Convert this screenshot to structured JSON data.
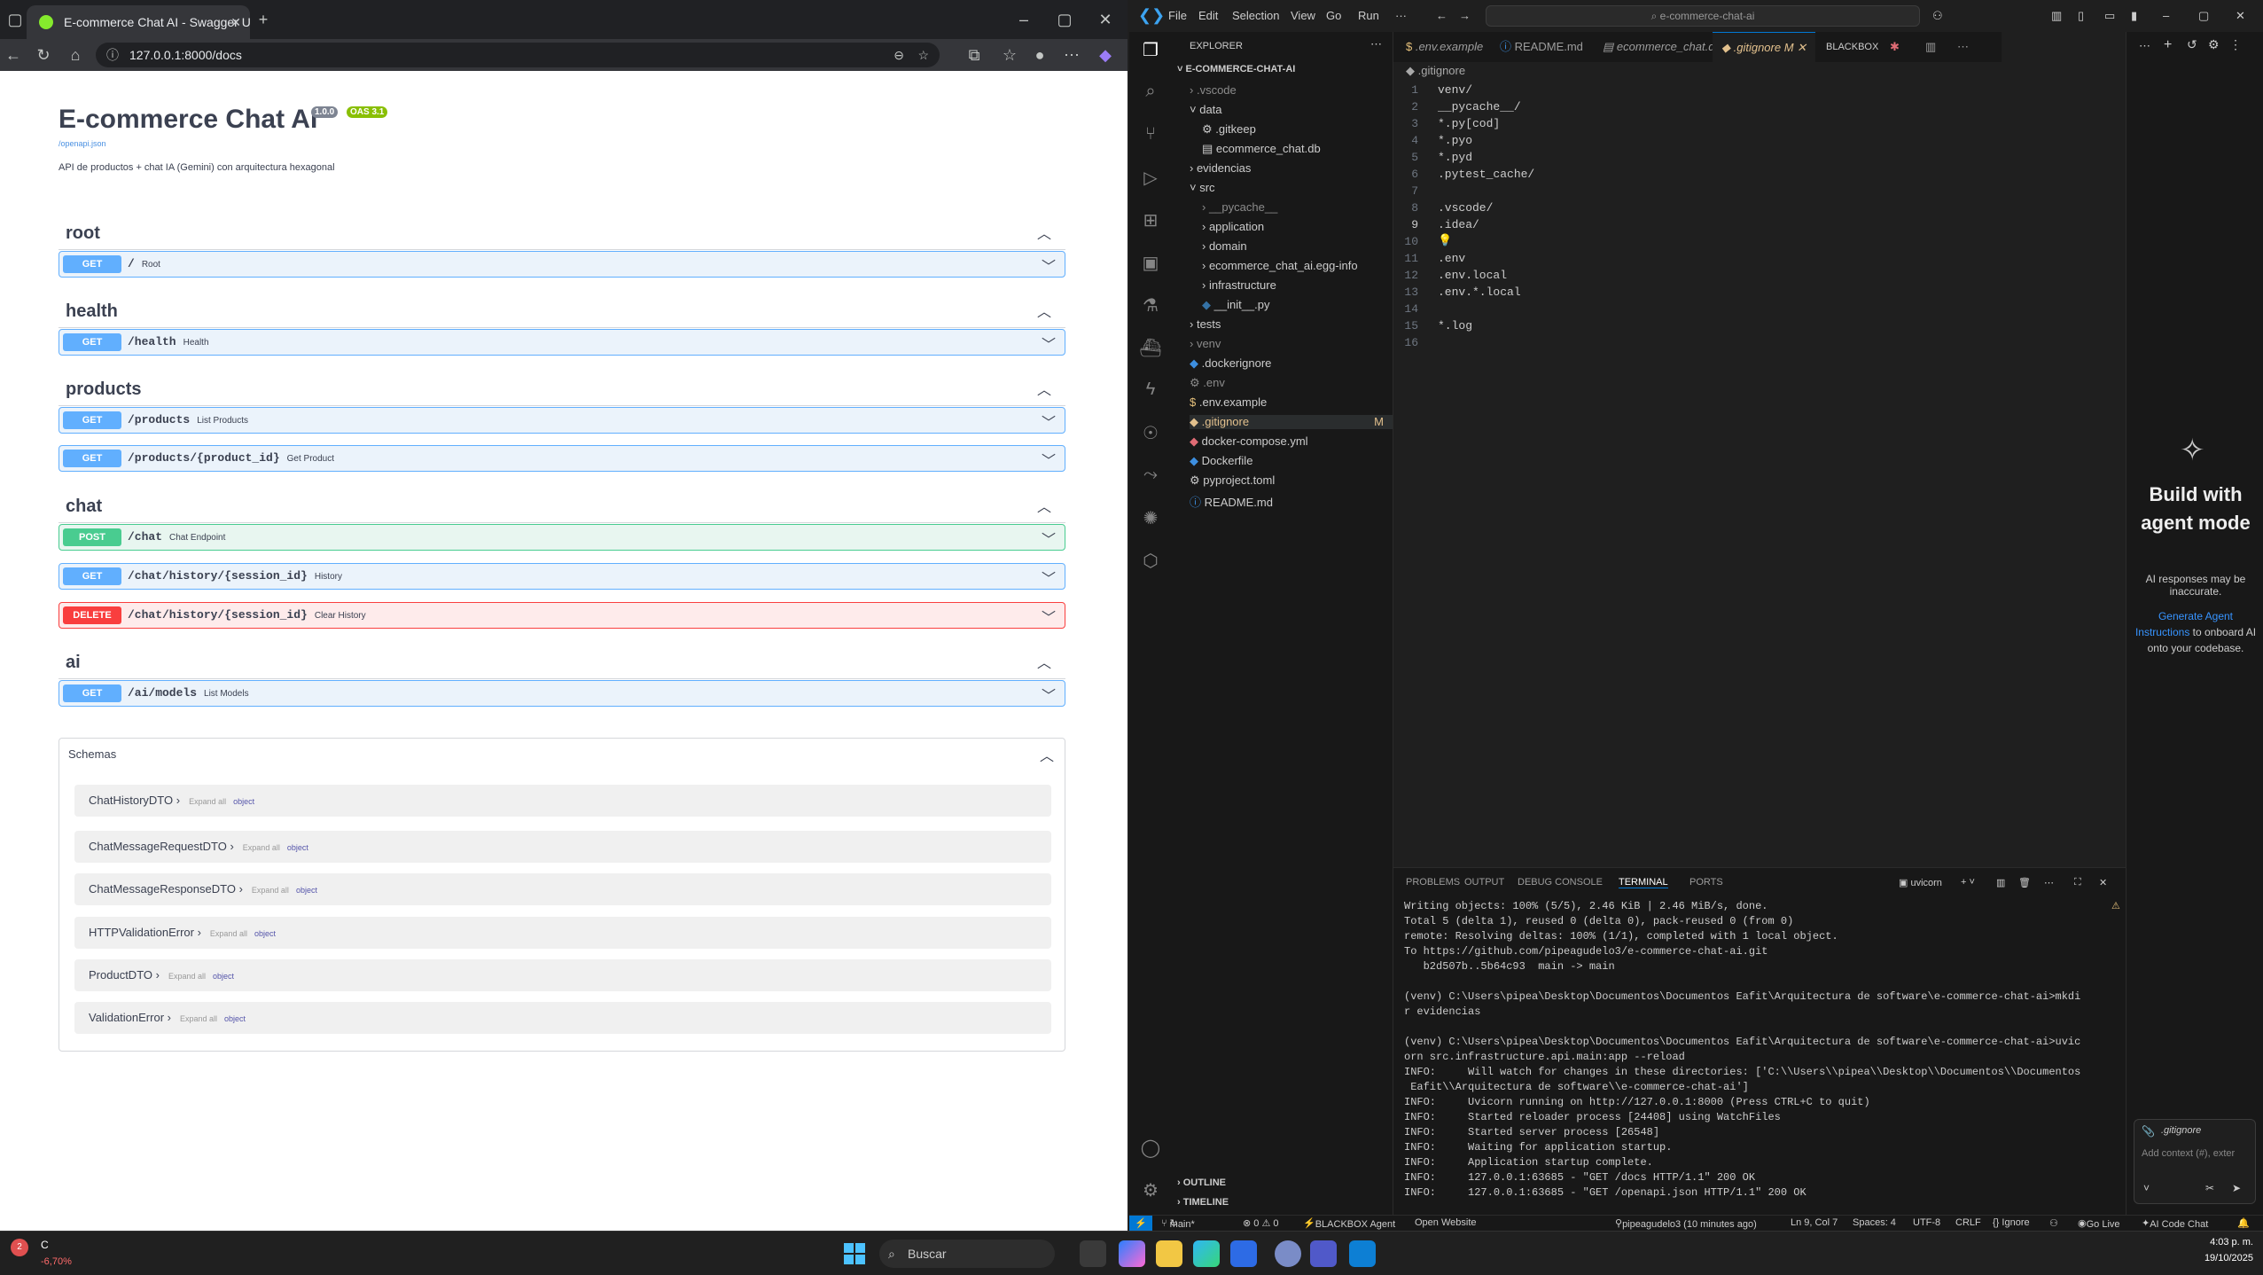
{
  "browser": {
    "tab_title": "E-commerce Chat AI - Swagger U",
    "url": "127.0.0.1:8000/docs"
  },
  "swagger": {
    "title": "E-commerce Chat AI",
    "version_badge": "1.0.0",
    "oas_badge": "OAS 3.1",
    "openapi_link": "/openapi.json",
    "description": "API de productos + chat IA (Gemini) con arquitectura hexagonal",
    "tags": [
      {
        "name": "root",
        "ops": [
          {
            "method": "GET",
            "path": "/",
            "summary": "Root"
          }
        ]
      },
      {
        "name": "health",
        "ops": [
          {
            "method": "GET",
            "path": "/health",
            "summary": "Health"
          }
        ]
      },
      {
        "name": "products",
        "ops": [
          {
            "method": "GET",
            "path": "/products",
            "summary": "List Products"
          },
          {
            "method": "GET",
            "path": "/products/{product_id}",
            "summary": "Get Product"
          }
        ]
      },
      {
        "name": "chat",
        "ops": [
          {
            "method": "POST",
            "path": "/chat",
            "summary": "Chat Endpoint"
          },
          {
            "method": "GET",
            "path": "/chat/history/{session_id}",
            "summary": "History"
          },
          {
            "method": "DELETE",
            "path": "/chat/history/{session_id}",
            "summary": "Clear History"
          }
        ]
      },
      {
        "name": "ai",
        "ops": [
          {
            "method": "GET",
            "path": "/ai/models",
            "summary": "List Models"
          }
        ]
      }
    ],
    "schemas_title": "Schemas",
    "expand_all": "Expand all",
    "object_label": "object",
    "schemas": [
      "ChatHistoryDTO",
      "ChatMessageRequestDTO",
      "ChatMessageResponseDTO",
      "HTTPValidationError",
      "ProductDTO",
      "ValidationError"
    ]
  },
  "vscode": {
    "menu": [
      "File",
      "Edit",
      "Selection",
      "View",
      "Go",
      "Run",
      "···"
    ],
    "search": "e-commerce-chat-ai",
    "explorer_title": "EXPLORER",
    "project": "E-COMMERCE-CHAT-AI",
    "tree": [
      ".vscode",
      "data",
      ".gitkeep",
      "ecommerce_chat.db",
      "evidencias",
      "src",
      "__pycache__",
      "application",
      "domain",
      "ecommerce_chat_ai.egg-info",
      "infrastructure",
      "__init__.py",
      "tests",
      "venv",
      ".dockerignore",
      ".env",
      ".env.example",
      ".gitignore",
      "docker-compose.yml",
      "Dockerfile",
      "pyproject.toml",
      "README.md"
    ],
    "modified_marker": "M",
    "tabs": [
      ".env.example",
      "README.md",
      "ecommerce_chat.db",
      ".gitignore M",
      "BLACKBOX"
    ],
    "breadcrumb": ".gitignore",
    "code_lines": [
      "venv/",
      "__pycache__/",
      "*.py[cod]",
      "*.pyo",
      "*.pyd",
      ".pytest_cache/",
      "",
      ".vscode/",
      ".idea/",
      "",
      ".env",
      ".env.local",
      ".env.*.local",
      "",
      "*.log",
      ""
    ],
    "line_numbers": [
      "1",
      "2",
      "3",
      "4",
      "5",
      "6",
      "7",
      "8",
      "9",
      "10",
      "11",
      "12",
      "13",
      "14",
      "15",
      "16"
    ],
    "panel_tabs": [
      "PROBLEMS",
      "OUTPUT",
      "DEBUG CONSOLE",
      "TERMINAL",
      "PORTS"
    ],
    "terminal_name": "uvicorn",
    "terminal_lines": [
      "Writing objects: 100% (5/5), 2.46 KiB | 2.46 MiB/s, done.",
      "Total 5 (delta 1), reused 0 (delta 0), pack-reused 0 (from 0)",
      "remote: Resolving deltas: 100% (1/1), completed with 1 local object.",
      "To https://github.com/pipeagudelo3/e-commerce-chat-ai.git",
      "   b2d507b..5b64c93  main -> main",
      "",
      "(venv) C:\\Users\\pipea\\Desktop\\Documentos\\Documentos Eafit\\Arquitectura de software\\e-commerce-chat-ai>mkdi",
      "r evidencias",
      "",
      "(venv) C:\\Users\\pipea\\Desktop\\Documentos\\Documentos Eafit\\Arquitectura de software\\e-commerce-chat-ai>uvic",
      "orn src.infrastructure.api.main:app --reload",
      "INFO:     Will watch for changes in these directories: ['C:\\\\Users\\\\pipea\\\\Desktop\\\\Documentos\\\\Documentos",
      " Eafit\\\\Arquitectura de software\\\\e-commerce-chat-ai']",
      "INFO:     Uvicorn running on http://127.0.0.1:8000 (Press CTRL+C to quit)",
      "INFO:     Started reloader process [24408] using WatchFiles",
      "INFO:     Started server process [26548]",
      "INFO:     Waiting for application startup.",
      "INFO:     Application startup complete.",
      "INFO:     127.0.0.1:63685 - \"GET /docs HTTP/1.1\" 200 OK",
      "INFO:     127.0.0.1:63685 - \"GET /openapi.json HTTP/1.1\" 200 OK"
    ],
    "chat_title": "Build with agent mode",
    "chat_note": "AI responses may be inaccurate.",
    "chat_link": "Generate Agent Instructions",
    "chat_note2": "to onboard AI onto your codebase.",
    "chat_context": ".gitignore",
    "chat_placeholder": "Add context (#), exter",
    "outline": "OUTLINE",
    "timeline": "TIMELINE",
    "status": {
      "branch": "main*",
      "errors": "⊗ 0 ⚠ 0",
      "blackbox": "BLACKBOX Agent",
      "open_website": "Open Website",
      "git_user": "pipeagudelo3 (10 minutes ago)",
      "position": "Ln 9, Col 7",
      "spaces": "Spaces: 4",
      "encoding": "UTF-8",
      "eol": "CRLF",
      "ignore": "{} Ignore",
      "golive": "Go Live",
      "aicode": "AI Code Chat"
    }
  },
  "taskbar": {
    "weather_temp": "C",
    "weather_change": "-6,70%",
    "search": "Buscar",
    "time": "4:03 p. m.",
    "date": "19/10/2025",
    "notif_count": "2"
  }
}
